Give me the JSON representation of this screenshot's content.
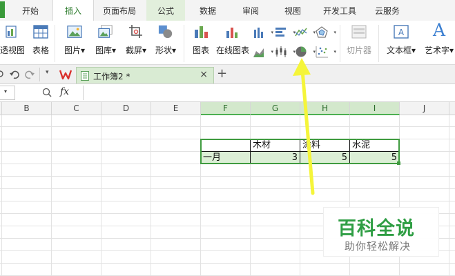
{
  "ribbon_tabs": [
    "开始",
    "插入",
    "页面布局",
    "公式",
    "数据",
    "审阅",
    "视图",
    "开发工具",
    "云服务"
  ],
  "active_tab": "插入",
  "ribbon": {
    "pivot_view": "透视图",
    "table": "表格",
    "picture": "图片",
    "gallery": "图库",
    "screenshot": "截屏",
    "shapes": "形状",
    "chart": "图表",
    "online_chart": "在线图表",
    "clip": "切片器",
    "textbox": "文本框",
    "wordart": "艺术字",
    "wordart_letter": "A",
    "dropdown_arrow": "▾"
  },
  "document": {
    "tab_title": "工作簿2 *",
    "close": "×",
    "new_tab": "+"
  },
  "formula_bar": {
    "fx": "fx",
    "dropdown_arrow": "▾"
  },
  "columns": [
    "B",
    "C",
    "D",
    "E",
    "F",
    "G",
    "H",
    "I",
    "J"
  ],
  "table": {
    "headers": [
      "木材",
      "涂料",
      "水泥"
    ],
    "row_label": "一月",
    "values": [
      3,
      5,
      5
    ]
  },
  "watermark": {
    "title": "百科全说",
    "subtitle": "助你轻松解决"
  },
  "colors": {
    "accent_green": "#3f9b3f",
    "arrow_yellow": "#f5f53a",
    "watermark_green": "#2f9e44"
  },
  "icons": [
    "pivot-icon",
    "table-icon",
    "picture-icon",
    "gallery-icon",
    "screenshot-icon",
    "shapes-icon",
    "chart-icon",
    "online-chart-icon",
    "column-chart-icon",
    "bar-chart-icon",
    "line-chart-icon",
    "radar-chart-icon",
    "area-chart-icon",
    "stock-chart-icon",
    "pie-chart-icon",
    "scatter-chart-icon",
    "slicer-icon",
    "textbox-icon",
    "wordart-icon",
    "undo-icon",
    "redo-icon",
    "wps-logo-icon",
    "search-icon"
  ]
}
